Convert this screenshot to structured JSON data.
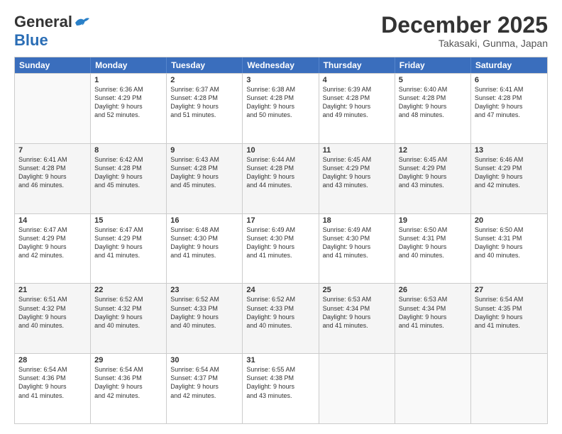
{
  "header": {
    "logo_line1": "General",
    "logo_line2": "Blue",
    "main_title": "December 2025",
    "subtitle": "Takasaki, Gunma, Japan"
  },
  "calendar": {
    "weekdays": [
      "Sunday",
      "Monday",
      "Tuesday",
      "Wednesday",
      "Thursday",
      "Friday",
      "Saturday"
    ],
    "rows": [
      [
        {
          "day": "",
          "lines": []
        },
        {
          "day": "1",
          "lines": [
            "Sunrise: 6:36 AM",
            "Sunset: 4:29 PM",
            "Daylight: 9 hours",
            "and 52 minutes."
          ]
        },
        {
          "day": "2",
          "lines": [
            "Sunrise: 6:37 AM",
            "Sunset: 4:28 PM",
            "Daylight: 9 hours",
            "and 51 minutes."
          ]
        },
        {
          "day": "3",
          "lines": [
            "Sunrise: 6:38 AM",
            "Sunset: 4:28 PM",
            "Daylight: 9 hours",
            "and 50 minutes."
          ]
        },
        {
          "day": "4",
          "lines": [
            "Sunrise: 6:39 AM",
            "Sunset: 4:28 PM",
            "Daylight: 9 hours",
            "and 49 minutes."
          ]
        },
        {
          "day": "5",
          "lines": [
            "Sunrise: 6:40 AM",
            "Sunset: 4:28 PM",
            "Daylight: 9 hours",
            "and 48 minutes."
          ]
        },
        {
          "day": "6",
          "lines": [
            "Sunrise: 6:41 AM",
            "Sunset: 4:28 PM",
            "Daylight: 9 hours",
            "and 47 minutes."
          ]
        }
      ],
      [
        {
          "day": "7",
          "lines": [
            "Sunrise: 6:41 AM",
            "Sunset: 4:28 PM",
            "Daylight: 9 hours",
            "and 46 minutes."
          ]
        },
        {
          "day": "8",
          "lines": [
            "Sunrise: 6:42 AM",
            "Sunset: 4:28 PM",
            "Daylight: 9 hours",
            "and 45 minutes."
          ]
        },
        {
          "day": "9",
          "lines": [
            "Sunrise: 6:43 AM",
            "Sunset: 4:28 PM",
            "Daylight: 9 hours",
            "and 45 minutes."
          ]
        },
        {
          "day": "10",
          "lines": [
            "Sunrise: 6:44 AM",
            "Sunset: 4:28 PM",
            "Daylight: 9 hours",
            "and 44 minutes."
          ]
        },
        {
          "day": "11",
          "lines": [
            "Sunrise: 6:45 AM",
            "Sunset: 4:29 PM",
            "Daylight: 9 hours",
            "and 43 minutes."
          ]
        },
        {
          "day": "12",
          "lines": [
            "Sunrise: 6:45 AM",
            "Sunset: 4:29 PM",
            "Daylight: 9 hours",
            "and 43 minutes."
          ]
        },
        {
          "day": "13",
          "lines": [
            "Sunrise: 6:46 AM",
            "Sunset: 4:29 PM",
            "Daylight: 9 hours",
            "and 42 minutes."
          ]
        }
      ],
      [
        {
          "day": "14",
          "lines": [
            "Sunrise: 6:47 AM",
            "Sunset: 4:29 PM",
            "Daylight: 9 hours",
            "and 42 minutes."
          ]
        },
        {
          "day": "15",
          "lines": [
            "Sunrise: 6:47 AM",
            "Sunset: 4:29 PM",
            "Daylight: 9 hours",
            "and 41 minutes."
          ]
        },
        {
          "day": "16",
          "lines": [
            "Sunrise: 6:48 AM",
            "Sunset: 4:30 PM",
            "Daylight: 9 hours",
            "and 41 minutes."
          ]
        },
        {
          "day": "17",
          "lines": [
            "Sunrise: 6:49 AM",
            "Sunset: 4:30 PM",
            "Daylight: 9 hours",
            "and 41 minutes."
          ]
        },
        {
          "day": "18",
          "lines": [
            "Sunrise: 6:49 AM",
            "Sunset: 4:30 PM",
            "Daylight: 9 hours",
            "and 41 minutes."
          ]
        },
        {
          "day": "19",
          "lines": [
            "Sunrise: 6:50 AM",
            "Sunset: 4:31 PM",
            "Daylight: 9 hours",
            "and 40 minutes."
          ]
        },
        {
          "day": "20",
          "lines": [
            "Sunrise: 6:50 AM",
            "Sunset: 4:31 PM",
            "Daylight: 9 hours",
            "and 40 minutes."
          ]
        }
      ],
      [
        {
          "day": "21",
          "lines": [
            "Sunrise: 6:51 AM",
            "Sunset: 4:32 PM",
            "Daylight: 9 hours",
            "and 40 minutes."
          ]
        },
        {
          "day": "22",
          "lines": [
            "Sunrise: 6:52 AM",
            "Sunset: 4:32 PM",
            "Daylight: 9 hours",
            "and 40 minutes."
          ]
        },
        {
          "day": "23",
          "lines": [
            "Sunrise: 6:52 AM",
            "Sunset: 4:33 PM",
            "Daylight: 9 hours",
            "and 40 minutes."
          ]
        },
        {
          "day": "24",
          "lines": [
            "Sunrise: 6:52 AM",
            "Sunset: 4:33 PM",
            "Daylight: 9 hours",
            "and 40 minutes."
          ]
        },
        {
          "day": "25",
          "lines": [
            "Sunrise: 6:53 AM",
            "Sunset: 4:34 PM",
            "Daylight: 9 hours",
            "and 41 minutes."
          ]
        },
        {
          "day": "26",
          "lines": [
            "Sunrise: 6:53 AM",
            "Sunset: 4:34 PM",
            "Daylight: 9 hours",
            "and 41 minutes."
          ]
        },
        {
          "day": "27",
          "lines": [
            "Sunrise: 6:54 AM",
            "Sunset: 4:35 PM",
            "Daylight: 9 hours",
            "and 41 minutes."
          ]
        }
      ],
      [
        {
          "day": "28",
          "lines": [
            "Sunrise: 6:54 AM",
            "Sunset: 4:36 PM",
            "Daylight: 9 hours",
            "and 41 minutes."
          ]
        },
        {
          "day": "29",
          "lines": [
            "Sunrise: 6:54 AM",
            "Sunset: 4:36 PM",
            "Daylight: 9 hours",
            "and 42 minutes."
          ]
        },
        {
          "day": "30",
          "lines": [
            "Sunrise: 6:54 AM",
            "Sunset: 4:37 PM",
            "Daylight: 9 hours",
            "and 42 minutes."
          ]
        },
        {
          "day": "31",
          "lines": [
            "Sunrise: 6:55 AM",
            "Sunset: 4:38 PM",
            "Daylight: 9 hours",
            "and 43 minutes."
          ]
        },
        {
          "day": "",
          "lines": []
        },
        {
          "day": "",
          "lines": []
        },
        {
          "day": "",
          "lines": []
        }
      ]
    ]
  }
}
